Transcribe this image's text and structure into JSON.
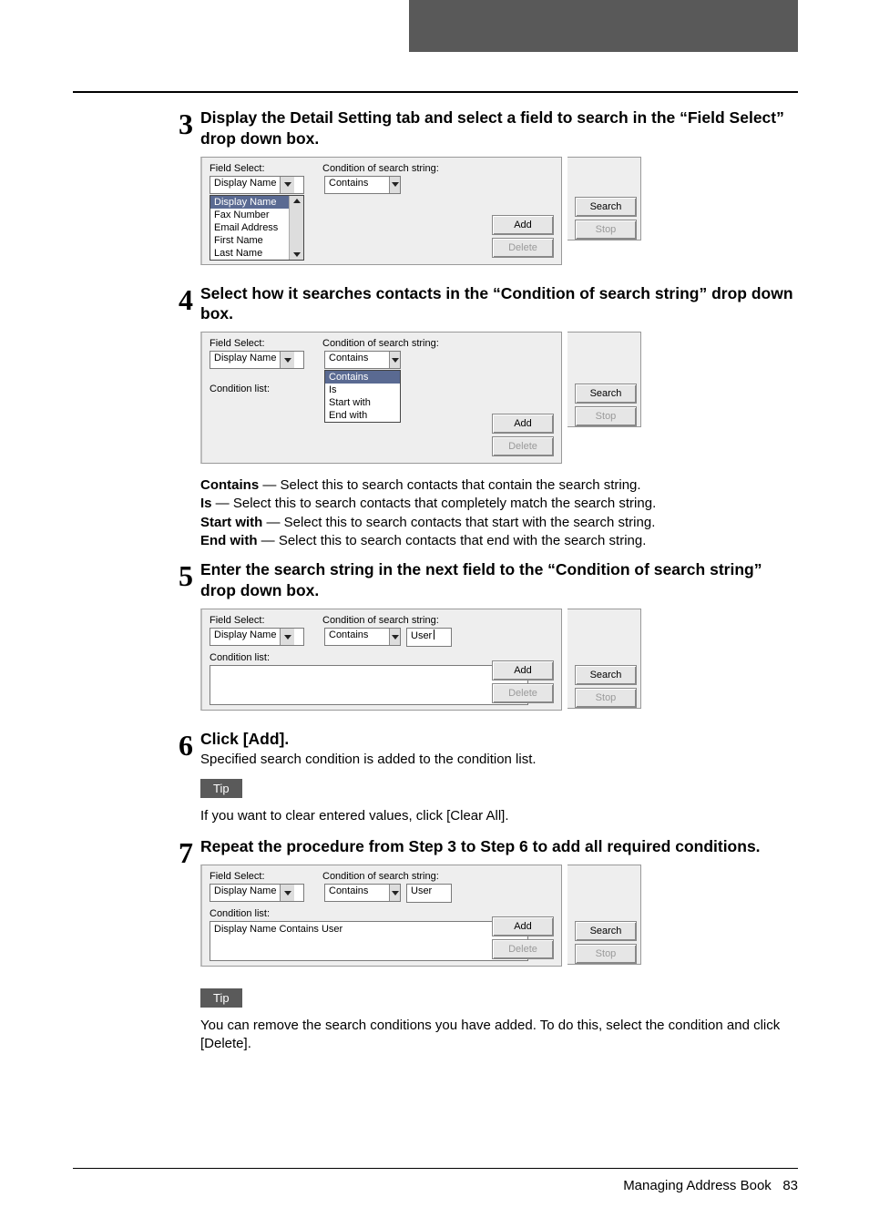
{
  "page_footer": {
    "title": "Managing Address Book",
    "page_num": "83"
  },
  "labels": {
    "field_select": "Field Select:",
    "condition_of_search": "Condition of search string:",
    "condition_list": "Condition list:",
    "add": "Add",
    "delete": "Delete",
    "search": "Search",
    "stop": "Stop"
  },
  "tip_label": "Tip",
  "steps": [
    {
      "num": "3",
      "title": "Display the Detail Setting tab and select a field to search in the “Field Select” drop down box."
    },
    {
      "num": "4",
      "title": "Select how it searches contacts in the “Condition of search string” drop down box."
    },
    {
      "num": "5",
      "title": "Enter the search string in the next field to the “Condition of search string” drop down box."
    },
    {
      "num": "6",
      "title": "Click [Add].",
      "desc": "Specified search condition is added to the condition list."
    },
    {
      "num": "7",
      "title": "Repeat the procedure from Step 3 to Step 6 to add all required conditions."
    }
  ],
  "tips": {
    "after6": "If you want to clear entered values, click [Clear All].",
    "after7": "You can remove the search conditions you have added. To do this, select the condition and click [Delete]."
  },
  "definitions": [
    {
      "term": "Contains",
      "desc": " — Select this to search contacts that contain the search string."
    },
    {
      "term": "Is",
      "desc": " — Select this to search contacts that completely match the search string."
    },
    {
      "term": "Start with",
      "desc": " — Select this to search contacts that start with the search string."
    },
    {
      "term": "End with",
      "desc": " — Select this to search contacts that end with the search string."
    }
  ],
  "fig3": {
    "field_select_value": "Display Name",
    "condition_value": "Contains",
    "list_items": [
      "Display Name",
      "Fax Number",
      "Email Address",
      "First Name",
      "Last Name"
    ]
  },
  "fig4": {
    "field_select_value": "Display Name",
    "condition_value": "Contains",
    "list_items": [
      "Contains",
      "Is",
      "Start with",
      "End with"
    ]
  },
  "fig5": {
    "field_select_value": "Display Name",
    "condition_value": "Contains",
    "input_value": "User"
  },
  "fig7": {
    "field_select_value": "Display Name",
    "condition_value": "Contains",
    "input_value": "User",
    "condition_list_entry": "Display Name Contains User"
  }
}
